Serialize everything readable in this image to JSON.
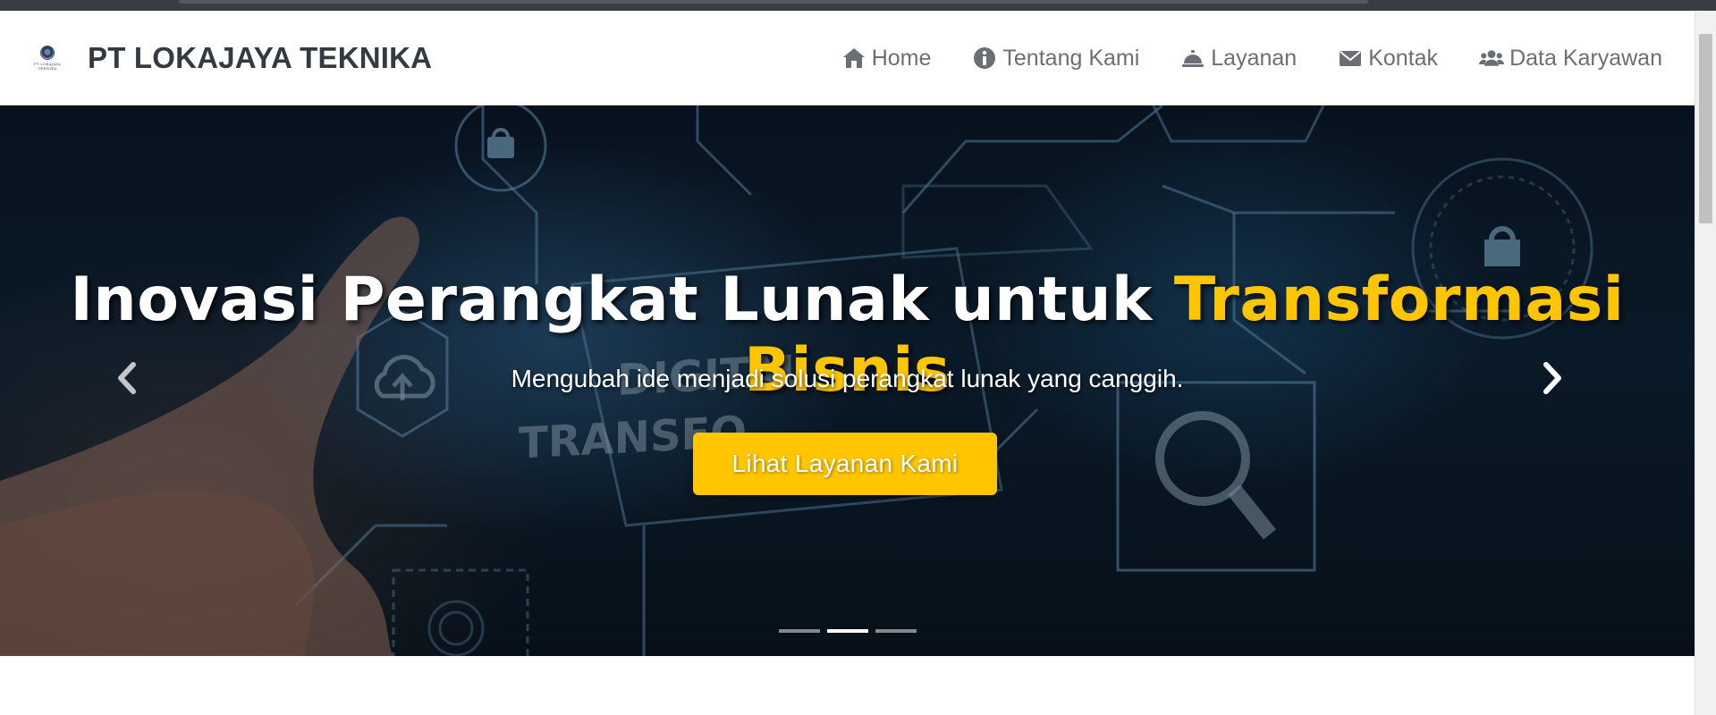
{
  "brand": {
    "logo_text": "PT LOKAJAYA TEKNIKA",
    "name": "PT LOKAJAYA TEKNIKA"
  },
  "nav": {
    "items": [
      {
        "label": "Home",
        "icon": "home-icon"
      },
      {
        "label": "Tentang Kami",
        "icon": "info-circle-icon"
      },
      {
        "label": "Layanan",
        "icon": "concierge-bell-icon"
      },
      {
        "label": "Kontak",
        "icon": "envelope-icon"
      },
      {
        "label": "Data Karyawan",
        "icon": "users-icon"
      }
    ]
  },
  "hero": {
    "title_main": "Inovasi Perangkat Lunak untuk ",
    "title_accent": "Transformasi Bisnis",
    "subtitle": "Mengubah ide menjadi solusi perangkat lunak yang canggih.",
    "cta_label": "Lihat Layanan Kami",
    "bg_text_1": "DIGITAL",
    "bg_text_2": "TRANSFO",
    "indicators": [
      {
        "active": false
      },
      {
        "active": true
      },
      {
        "active": false
      }
    ]
  },
  "colors": {
    "accent": "#ffc600",
    "nav_text": "#6b6f75",
    "brand_text": "#333a40"
  }
}
